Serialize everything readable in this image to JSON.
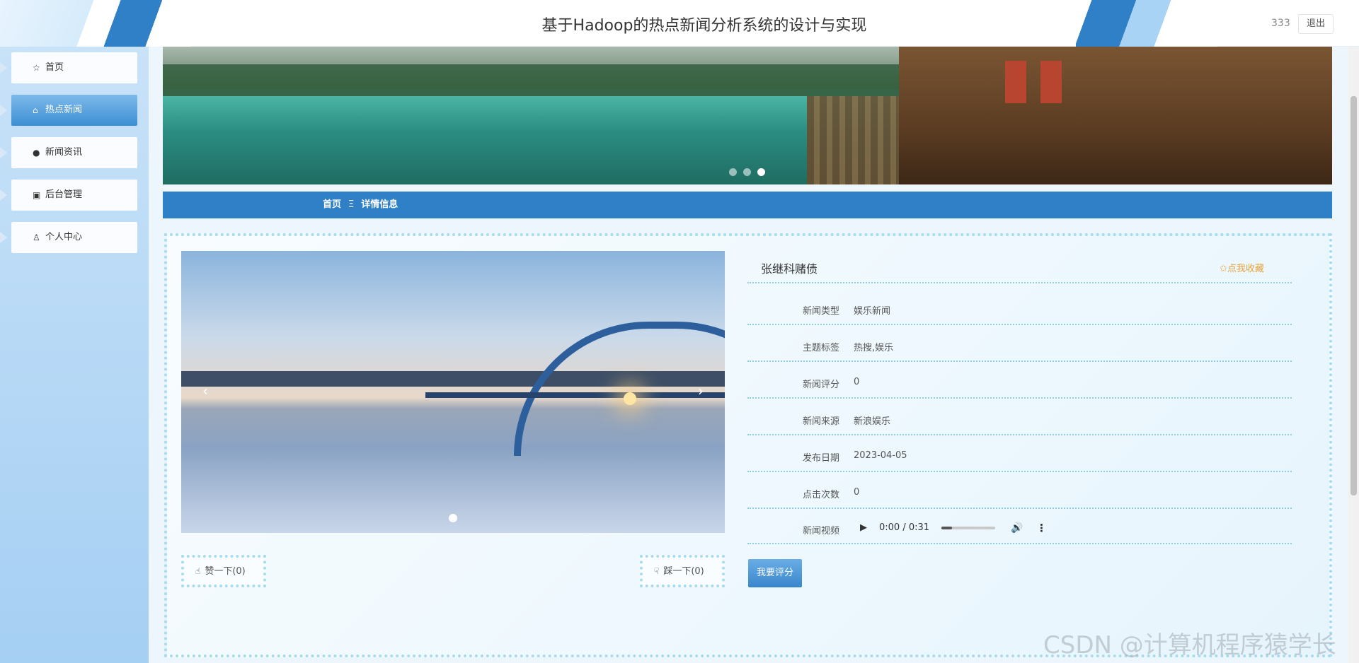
{
  "header": {
    "title": "基于Hadoop的热点新闻分析系统的设计与实现",
    "username": "333",
    "logout_label": "退出"
  },
  "sidebar": {
    "items": [
      {
        "label": "首页",
        "icon": "star-icon"
      },
      {
        "label": "热点新闻",
        "icon": "bag-icon",
        "active": true
      },
      {
        "label": "新闻资讯",
        "icon": "info-icon"
      },
      {
        "label": "后台管理",
        "icon": "box-icon"
      },
      {
        "label": "个人中心",
        "icon": "user-icon"
      }
    ]
  },
  "banner": {
    "slide_count": 3,
    "active_slide": 3
  },
  "breadcrumb": {
    "home": "首页",
    "separator": "Ξ",
    "current": "详情信息"
  },
  "detail": {
    "title": "张继科赌债",
    "favorite_label": "✩点我收藏",
    "fields": [
      {
        "label": "新闻类型",
        "value": "娱乐新闻"
      },
      {
        "label": "主题标签",
        "value": "热搜,娱乐"
      },
      {
        "label": "新闻评分",
        "value": "0"
      },
      {
        "label": "新闻来源",
        "value": "新浪娱乐"
      },
      {
        "label": "发布日期",
        "value": "2023-04-05"
      },
      {
        "label": "点击次数",
        "value": "0"
      }
    ],
    "video_label": "新闻视频",
    "audio_time": "0:00 / 0:31",
    "rate_button": "我要评分"
  },
  "votes": {
    "like": "赞一下(0)",
    "dislike": "踩一下(0)"
  },
  "watermark": "CSDN @计算机程序猿学长",
  "colors": {
    "primary": "#2f80c7",
    "accent": "#e6a23c",
    "sidebar": "#a5cff3"
  }
}
